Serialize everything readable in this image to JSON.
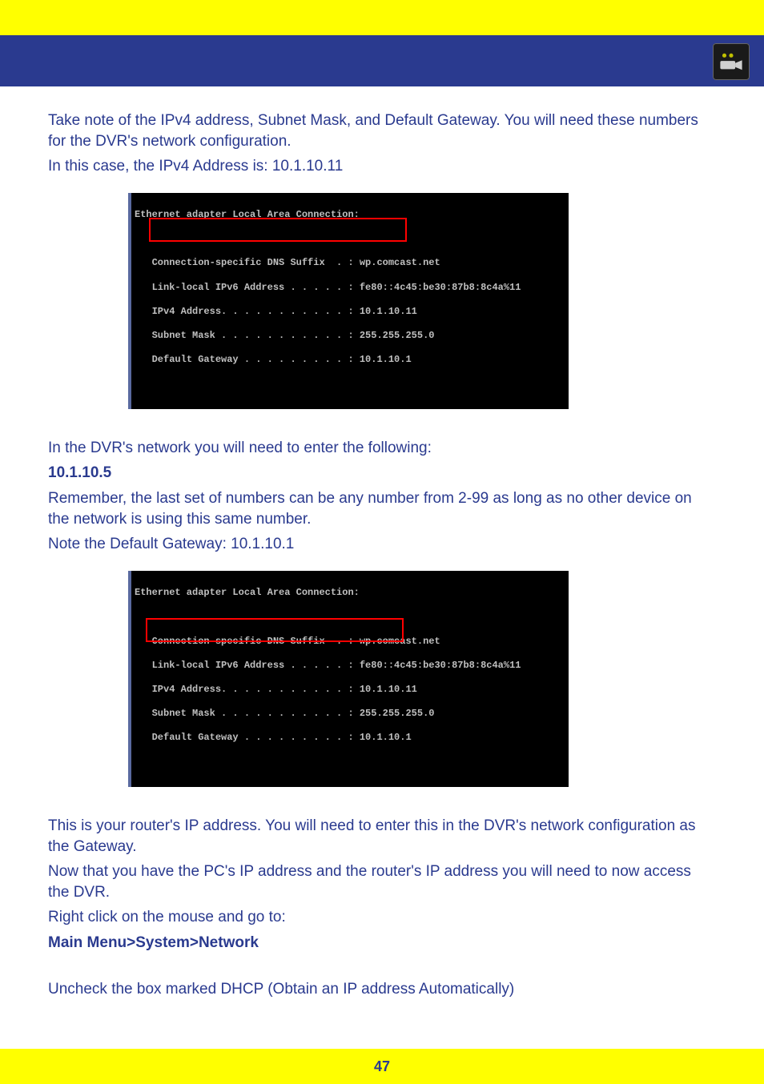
{
  "header": {
    "icon_name": "dvr-camera-icon"
  },
  "intro_paragraphs": [
    "Take note of the IPv4 address, Subnet Mask, and Default Gateway. You will need these numbers for the DVR's network configuration.",
    "In this case, the IPv4 Address is: 10.1.10.11"
  ],
  "cmd_block_1": {
    "title": "Ethernet adapter Local Area Connection:",
    "rows": [
      "Connection-specific DNS Suffix  . : wp.comcast.net",
      "Link-local IPv6 Address . . . . . : fe80::4c45:be30:87b8:8c4a%11",
      "IPv4 Address. . . . . . . . . . . : 10.1.10.11",
      "Subnet Mask . . . . . . . . . . . : 255.255.255.0",
      "Default Gateway . . . . . . . . . : 10.1.10.1"
    ],
    "highlight_box_description": "IPv4 Address / Subnet Mask row boxed in red"
  },
  "mid_paragraphs": [
    {
      "text": "In the DVR's network you will need to enter the following:"
    },
    {
      "text": "10.1.10.5",
      "bold": true
    },
    {
      "text": "Remember, the last set of numbers can be any number from 2-99 as long as no other device on the network is using this same number."
    },
    {
      "text": "Note the Default Gateway: 10.1.10.1"
    }
  ],
  "cmd_block_2": {
    "title": "Ethernet adapter Local Area Connection:",
    "rows": [
      "Connection-specific DNS Suffix  . : wp.comcast.net",
      "Link-local IPv6 Address . . . . . : fe80::4c45:be30:87b8:8c4a%11",
      "IPv4 Address. . . . . . . . . . . : 10.1.10.11",
      "Subnet Mask . . . . . . . . . . . : 255.255.255.0",
      "Default Gateway . . . . . . . . . : 10.1.10.1"
    ],
    "highlight_box_description": "Subnet Mask / Default Gateway row boxed in red"
  },
  "trailing_paragraphs": [
    "This is your router's IP address. You will need to enter this in the DVR's network configuration as the Gateway.",
    "Now that you have the PC's IP address and the router's IP address you will need to now access the DVR.",
    "Right click on the mouse and go to:",
    "Main Menu>System>Network",
    "Uncheck the box marked DHCP (Obtain an IP address Automatically)"
  ],
  "footer": {
    "page_number": "47"
  }
}
